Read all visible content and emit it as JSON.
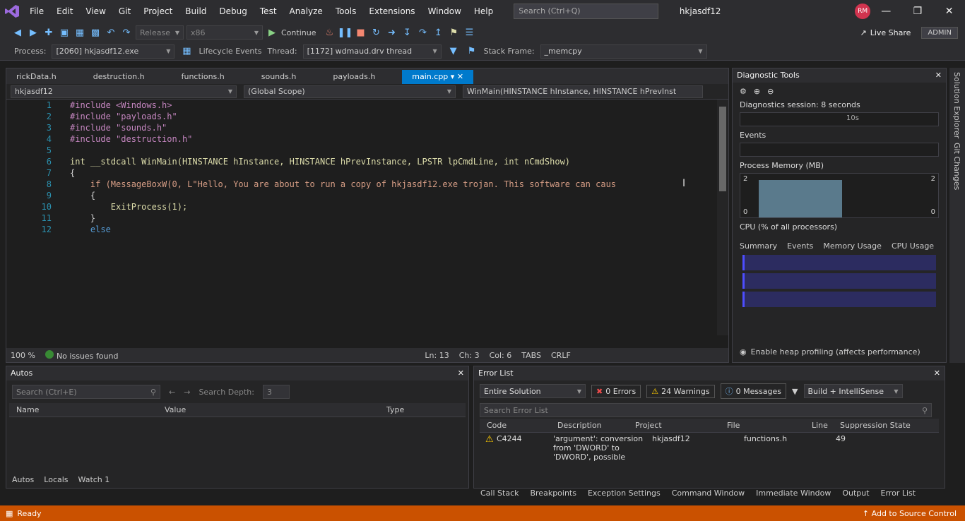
{
  "menubar": {
    "items": [
      "File",
      "Edit",
      "View",
      "Git",
      "Project",
      "Build",
      "Debug",
      "Test",
      "Analyze",
      "Tools",
      "Extensions",
      "Window",
      "Help"
    ],
    "search_placeholder": "Search (Ctrl+Q)",
    "solution_title": "hkjasdf12",
    "avatar_initials": "RM",
    "accent": "#007acc"
  },
  "toolbar": {
    "config": "Release",
    "platform": "x86",
    "continue_label": "Continue",
    "liveshare_label": "Live Share",
    "admin_label": "ADMIN"
  },
  "debugbar": {
    "process_label": "Process:",
    "process_value": "[2060] hkjasdf12.exe",
    "lifecycle_label": "Lifecycle Events",
    "thread_label": "Thread:",
    "thread_value": "[1172] wdmaud.drv thread",
    "stackframe_label": "Stack Frame:",
    "stackframe_value": "_memcpy"
  },
  "editor": {
    "tabs": [
      "rickData.h",
      "destruction.h",
      "functions.h",
      "sounds.h",
      "payloads.h",
      "main.cpp"
    ],
    "active_tab": "main.cpp",
    "nav_project": "hkjasdf12",
    "nav_scope": "(Global Scope)",
    "nav_member": "WinMain(HINSTANCE hInstance, HINSTANCE hPrevInst",
    "line_numbers": [
      "1",
      "2",
      "3",
      "4",
      "5",
      "6",
      "7",
      "8",
      "9",
      "10",
      "11",
      "12"
    ],
    "code_lines": [
      "#include <Windows.h>",
      "#include \"payloads.h\"",
      "#include \"sounds.h\"",
      "#include \"destruction.h\"",
      "",
      "int __stdcall WinMain(HINSTANCE hInstance, HINSTANCE hPrevInstance, LPSTR lpCmdLine, int nCmdShow)",
      "{",
      "    if (MessageBoxW(0, L\"Hello, You are about to run a copy of hkjasdf12.exe trojan. This software can caus",
      "    {",
      "        ExitProcess(1);",
      "    }",
      "    else"
    ],
    "zoom": "100 %",
    "issues": "No issues found",
    "ln": "Ln: 13",
    "ch": "Ch: 3",
    "col": "Col: 6",
    "tabs_mode": "TABS",
    "eol": "CRLF"
  },
  "diagnostics": {
    "title": "Diagnostic Tools",
    "session": "Diagnostics session: 8 seconds",
    "time_tick": "10s",
    "events_label": "Events",
    "memory_label": "Process Memory (MB)",
    "mem_axis_top": "2",
    "mem_axis_bottom": "0",
    "mem_axis_right_top": "2",
    "mem_axis_right_bottom": "0",
    "cpu_label": "CPU (% of all processors)",
    "tabs": [
      "Summary",
      "Events",
      "Memory Usage",
      "CPU Usage"
    ],
    "heap_label": "Enable heap profiling (affects performance)",
    "memory_fill_fraction": 0.86
  },
  "sidestrip": {
    "items": [
      "Solution Explorer",
      "Git Changes"
    ]
  },
  "autos": {
    "title": "Autos",
    "search_placeholder": "Search (Ctrl+E)",
    "search_depth_label": "Search Depth:",
    "search_depth_value": "3",
    "columns": [
      "Name",
      "Value",
      "Type"
    ],
    "bottom_tabs": [
      "Autos",
      "Locals",
      "Watch 1"
    ]
  },
  "errorlist": {
    "title": "Error List",
    "scope": "Entire Solution",
    "errors": "0 Errors",
    "warnings": "24 Warnings",
    "messages": "0 Messages",
    "build_filter": "Build + IntelliSense",
    "search_placeholder": "Search Error List",
    "columns": [
      "Code",
      "Description",
      "Project",
      "File",
      "Line",
      "Suppression State"
    ],
    "row": {
      "code": "C4244",
      "description": "'argument': conversion from 'DWORD' to 'DWORD', possible",
      "project": "hkjasdf12",
      "file": "functions.h",
      "line": "49"
    }
  },
  "bottom_tabs": [
    "Call Stack",
    "Breakpoints",
    "Exception Settings",
    "Command Window",
    "Immediate Window",
    "Output",
    "Error List"
  ],
  "status": {
    "left": "Ready",
    "right": "Add to Source Control",
    "color": "#ca5100"
  }
}
